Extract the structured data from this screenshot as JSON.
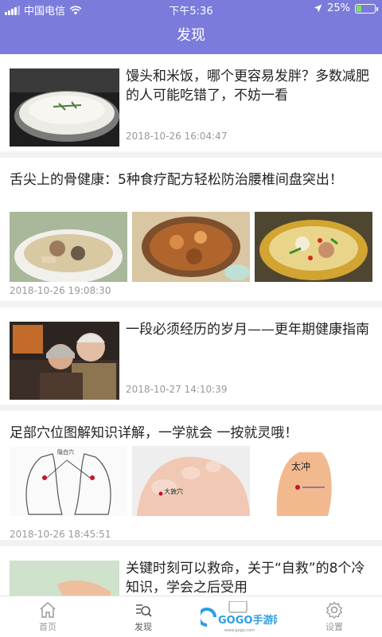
{
  "status": {
    "carrier": "中国电信",
    "time": "下午5:36",
    "battery": "25%",
    "battery_level": 0.25
  },
  "navbar": {
    "title": "发现"
  },
  "articles": [
    {
      "title": "馒头和米饭，哪个更容易发胖？多数减肥的人可能吃错了，不妨一看",
      "time": "2018-10-26 16:04:47"
    },
    {
      "title": "舌尖上的骨健康：5种食疗配方轻松防治腰椎间盘突出！",
      "time": "2018-10-26 19:08:30"
    },
    {
      "title": "一段必须经历的岁月——更年期健康指南",
      "time": "2018-10-27 14:10:39"
    },
    {
      "title": "足部穴位图解知识详解，一学就会 一按就灵哦！",
      "time": "2018-10-26 18:45:51",
      "labels": {
        "a": "隐白穴",
        "b": "大敦穴",
        "c": "太冲"
      }
    },
    {
      "title": "关键时刻可以救命，关于“自救”的8个冷知识，学会之后受用"
    }
  ],
  "tabs": [
    {
      "label": "首页",
      "icon": "home-icon"
    },
    {
      "label": "发现",
      "icon": "discover-icon"
    },
    {
      "label": "",
      "icon": "watermark"
    },
    {
      "label": "设置",
      "icon": "settings-icon"
    }
  ],
  "watermark": {
    "text": "GOGO手游网",
    "sub": "www.gogo.com"
  },
  "colors": {
    "accent": "#7b7bdc",
    "text": "#222222",
    "meta": "#999999"
  }
}
